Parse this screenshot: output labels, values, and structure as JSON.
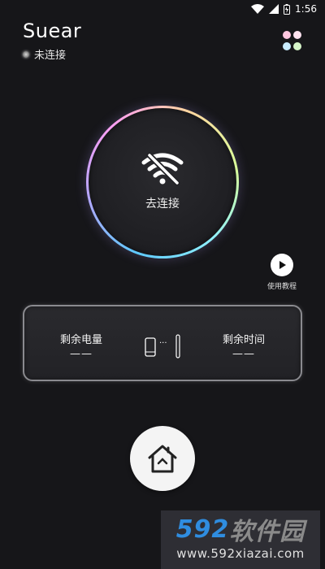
{
  "status_bar": {
    "time": "1:56"
  },
  "app": {
    "title": "Suear",
    "connection_status": "未连接"
  },
  "menu": {
    "dot_colors": [
      "#ffc7e0",
      "#ffe3f0",
      "#c9ecff",
      "#d6f5c9"
    ]
  },
  "connect": {
    "label": "去连接",
    "icon": "wifi-off-icon"
  },
  "tutorial": {
    "label": "使用教程",
    "icon": "play-icon"
  },
  "info_card": {
    "battery_label": "剩余电量",
    "battery_value": "——",
    "time_label": "剩余时间",
    "time_value": "——",
    "connector": "···"
  },
  "home": {
    "icon": "home-icon"
  },
  "watermark": {
    "num": "592",
    "cn": "软件园",
    "url": "www.592xiazai.com"
  }
}
